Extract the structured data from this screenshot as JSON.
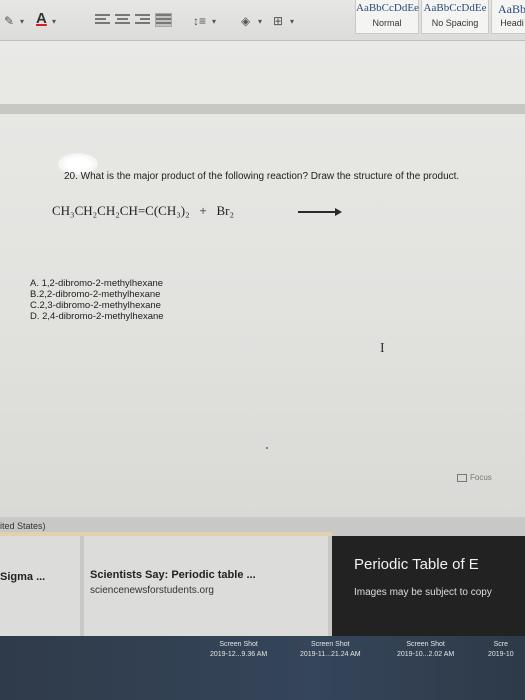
{
  "ribbon": {
    "font_color_letter": "A",
    "styles": [
      {
        "sample": "AaBbCcDdEe",
        "name": "Normal"
      },
      {
        "sample": "AaBbCcDdEe",
        "name": "No Spacing"
      },
      {
        "sample": "AaBb",
        "name": "Headi"
      }
    ]
  },
  "document": {
    "question": "20. What is the major product of the following reaction? Draw the structure of the product.",
    "reaction": {
      "reactant": "CH₃CH₂CH₂CH=C(CH₃)₂",
      "plus": "+",
      "reagent": "Br₂"
    },
    "options": [
      "A. 1,2-dibromo-2-methylhexane",
      "B.2,2-dibromo-2-methylhexane",
      "C.2,3-dibromo-2-methylhexane",
      "D. 2,4-dibromo-2-methylhexane"
    ],
    "cursor_glyph": "I",
    "focus_label": "Focus"
  },
  "lower": {
    "tab_label": "ited States)",
    "sigma": "Sigma ...",
    "sci_title": "Scientists Say: Periodic table ...",
    "sci_site": "sciencenewsforstudents.org",
    "pt_title": "Periodic Table of E",
    "pt_note": "Images may be subject to copy"
  },
  "screenshots": [
    {
      "label": "Screen Shot",
      "date": "2019-12...9.36 AM"
    },
    {
      "label": "Screen Shot",
      "date": "2019-11...21.24 AM"
    },
    {
      "label": "Screen Shot",
      "date": "2019-10...2.02 AM"
    },
    {
      "label": "Scre",
      "date": "2019-10"
    }
  ]
}
